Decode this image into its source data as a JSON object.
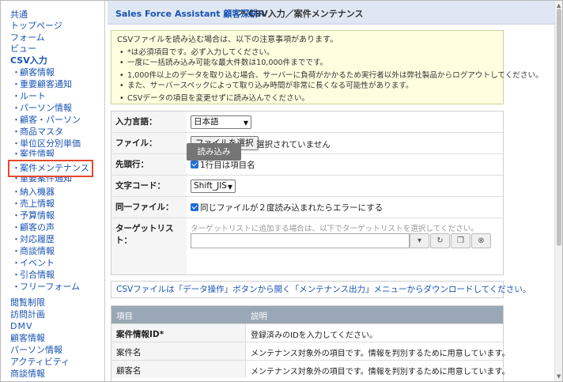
{
  "sidebar": {
    "top_items": [
      "共通",
      "トップページ",
      "フォーム",
      "ビュー"
    ],
    "csv_section": "CSV入力",
    "csv_items": [
      "顧客情報",
      "重要顧客通知",
      "ルート",
      "パーソン情報",
      "顧客・パーソン",
      "商品マスタ",
      "単位区分別単価",
      "案件情報",
      "案件メンテナンス",
      "重要案件通知",
      "納入機器",
      "売上情報",
      "予算情報",
      "顧客の声",
      "対応履歴",
      "商談情報",
      "イベント",
      "引合情報",
      "フリーフォーム"
    ],
    "bottom_items": [
      "閲覧制限",
      "訪問計画",
      "DMV",
      "顧客情報",
      "パーソン情報",
      "アクティビティ",
      "商談情報"
    ],
    "bullet": "・"
  },
  "header": {
    "app_link": "Sales Force Assistant 顧客深耕R",
    "separator": ">",
    "current": "CSV入力／案件メンテナンス"
  },
  "notice": {
    "lead": "CSVファイルを読み込む場合は、以下の注意事項があります。",
    "items": [
      "*は必須項目です。必ず入力してください。",
      "一度に一括読み込み可能な最大件数は10,000件までです。",
      "1,000件以上のデータを取り込む場合、サーバーに負荷がかかるため実行者以外は弊社製品からログアウトしてください。",
      "また、サーバースペックによって取り込み時間が非常に長くなる可能性があります。",
      "CSVデータの項目を変更せずに読み込んでください。"
    ]
  },
  "form": {
    "language_label": "入力言語：",
    "language_value": "日本語",
    "file_label": "ファイル：",
    "file_button": "ファイルを選択",
    "file_status": "選択されていません",
    "header_row_label": "先頭行：",
    "header_row_check": "1行目は項目名",
    "charcode_label": "文字コード：",
    "charcode_value": "Shift_JIS",
    "same_file_label": "同一ファイル：",
    "same_file_check": "同じファイルが２度読み込まれたらエラーにする",
    "target_label": "ターゲットリスト：",
    "target_hint": "ターゲットリストに追加する場合は、以下でターゲットリストを選択してください。",
    "load_button": "読み込み"
  },
  "info_text": "CSVファイルは「データ操作」ボタンから開く「メンテナンス出力」メニューからダウンロードしてください。",
  "table": {
    "col_item": "項目",
    "col_desc": "説明",
    "rows": [
      {
        "item": "案件情報ID*",
        "desc": "登録済みのIDを入力してください。"
      },
      {
        "item": "案件名",
        "desc": "メンテナンス対象外の項目です。情報を判別するために用意しています。"
      },
      {
        "item": "顧客名",
        "desc": "メンテナンス対象外の項目です。情報を判別するために用意しています。"
      }
    ]
  },
  "colors": {
    "link": "#1a53b4",
    "highlight": "#e5492b",
    "header_bg": "#dfe7f3",
    "notice_bg": "#ffffe0",
    "table_head": "#9aa7b6",
    "button": "#757575"
  },
  "icons": {
    "dropdown": "chevron-down-icon",
    "refresh": "refresh-icon",
    "copy": "copy-icon",
    "clear": "clear-icon"
  }
}
